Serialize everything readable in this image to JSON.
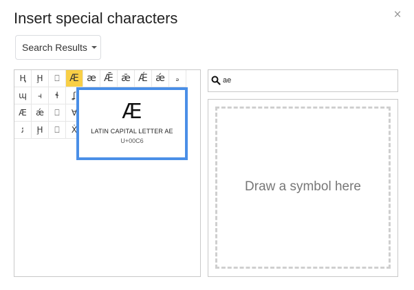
{
  "dialog": {
    "title": "Insert special characters",
    "close_glyph": "×"
  },
  "category_dropdown": {
    "label": "Search Results"
  },
  "search": {
    "value": "ae",
    "icon": "search-icon"
  },
  "grid": {
    "rows": [
      [
        "Ⱨ",
        "Ḩ",
        "⎕",
        "Æ",
        "æ",
        "Ǣ",
        "ǣ",
        "Ǽ",
        "ǽ",
        "ₔ"
      ],
      [
        "ɰ",
        "⫞",
        "ɬ",
        "ʆ",
        "",
        "",
        "",
        "",
        "",
        ""
      ],
      [
        "Æ",
        "ǽ",
        "⎕",
        "∀",
        "",
        "",
        "",
        "",
        "",
        ""
      ],
      [
        "ﺋ",
        "Ḩ",
        "⎕",
        "Ẋ",
        "",
        "",
        "",
        "",
        "",
        ""
      ]
    ],
    "selected_char": "Æ"
  },
  "preview": {
    "glyph": "Æ",
    "name": "LATIN CAPITAL LETTER AE",
    "code": "U+00C6"
  },
  "draw": {
    "placeholder": "Draw a symbol here"
  },
  "colors": {
    "selected_cell": "#f8cf46",
    "preview_border": "#4a8fe7"
  }
}
